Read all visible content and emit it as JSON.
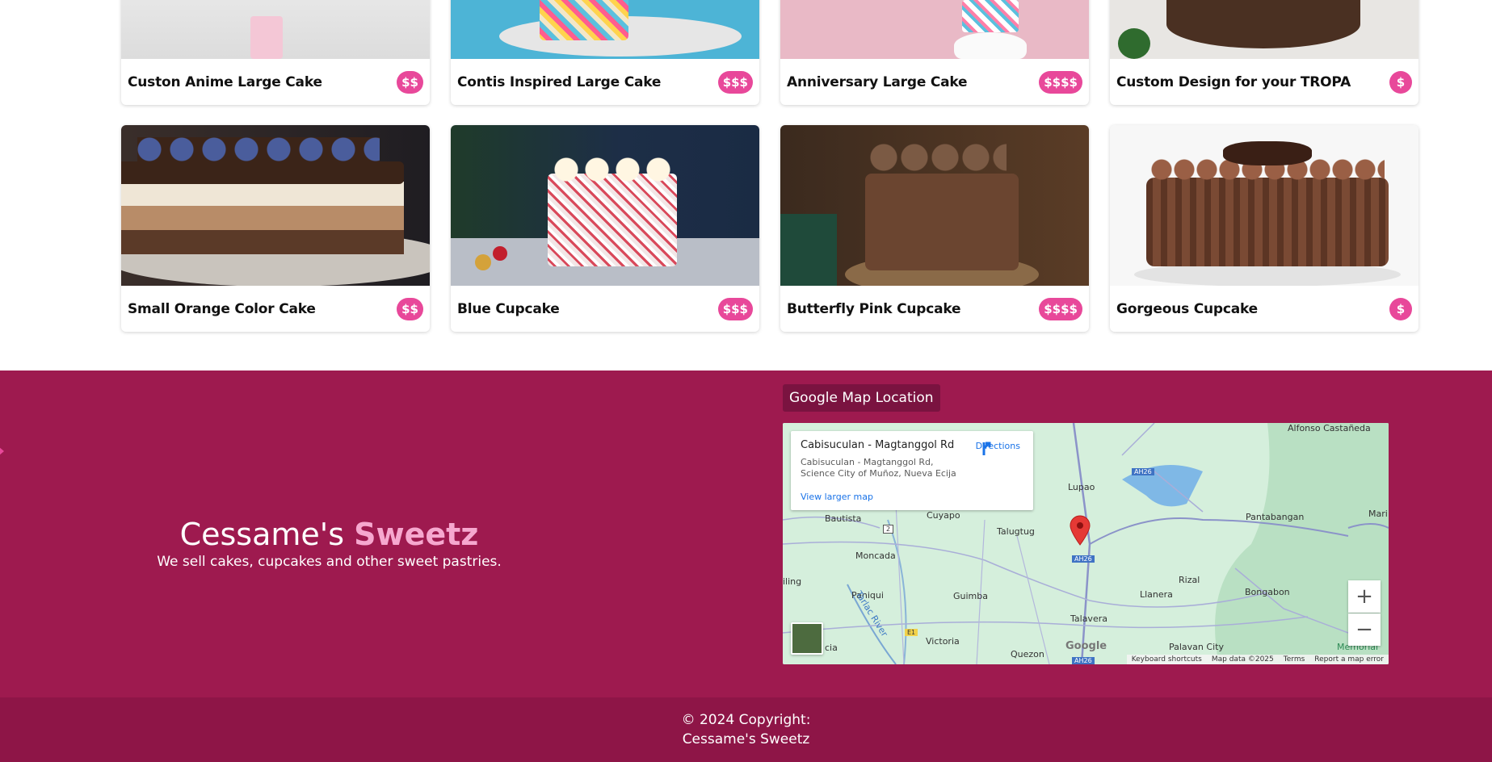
{
  "products": [
    {
      "title": "Custon Anime Large Cake",
      "price": "$$"
    },
    {
      "title": "Contis Inspired Large Cake",
      "price": "$$$"
    },
    {
      "title": "Anniversary Large Cake",
      "price": "$$$$"
    },
    {
      "title": "Custom Design for your TROPA",
      "price": "$"
    },
    {
      "title": "Small Orange Color Cake",
      "price": "$$"
    },
    {
      "title": "Blue Cupcake",
      "price": "$$$"
    },
    {
      "title": "Butterfly Pink Cupcake",
      "price": "$$$$"
    },
    {
      "title": "Gorgeous Cupcake",
      "price": "$"
    }
  ],
  "brand": {
    "name_prefix": "Cessame's ",
    "name_accent": "Sweetz",
    "tagline": "We sell cakes, cupcakes and other sweet pastries."
  },
  "map": {
    "label": "Google Map Location",
    "place_title": "Cabisuculan - Magtanggol Rd",
    "address_line1": "Cabisuculan - Magtanggol Rd,",
    "address_line2": "Science City of Muñoz, Nueva Ecija",
    "directions": "Directions",
    "view_larger": "View larger map",
    "zoom_in": "+",
    "zoom_out": "−",
    "attribution": [
      "Keyboard shortcuts",
      "Map data ©2025",
      "Terms",
      "Report a map error"
    ],
    "google": "Google",
    "places": [
      "Alfonso Castañeda",
      "Lupao",
      "Pantabangan",
      "Mari",
      "Bautista",
      "Cuyapo",
      "Talugtug",
      "Moncada",
      "Paniqui",
      "Guimba",
      "Rizal",
      "Llanera",
      "Bongabon",
      "Talavera",
      "Victoria",
      "Quezon",
      "Palavan City",
      "Memorial",
      "iling",
      "cia",
      "Tarlac River"
    ],
    "road_labels": [
      "AH26",
      "AH26",
      "AH26",
      "2",
      "E1"
    ]
  },
  "copyright": {
    "line1": "© 2024 Copyright:",
    "line2": "Cessame's Sweetz"
  },
  "colors": {
    "accent": "#e8489a",
    "footer": "#9e1a4f",
    "copyright_bar": "#8e1547",
    "brand_accent": "#f6a8cf"
  }
}
